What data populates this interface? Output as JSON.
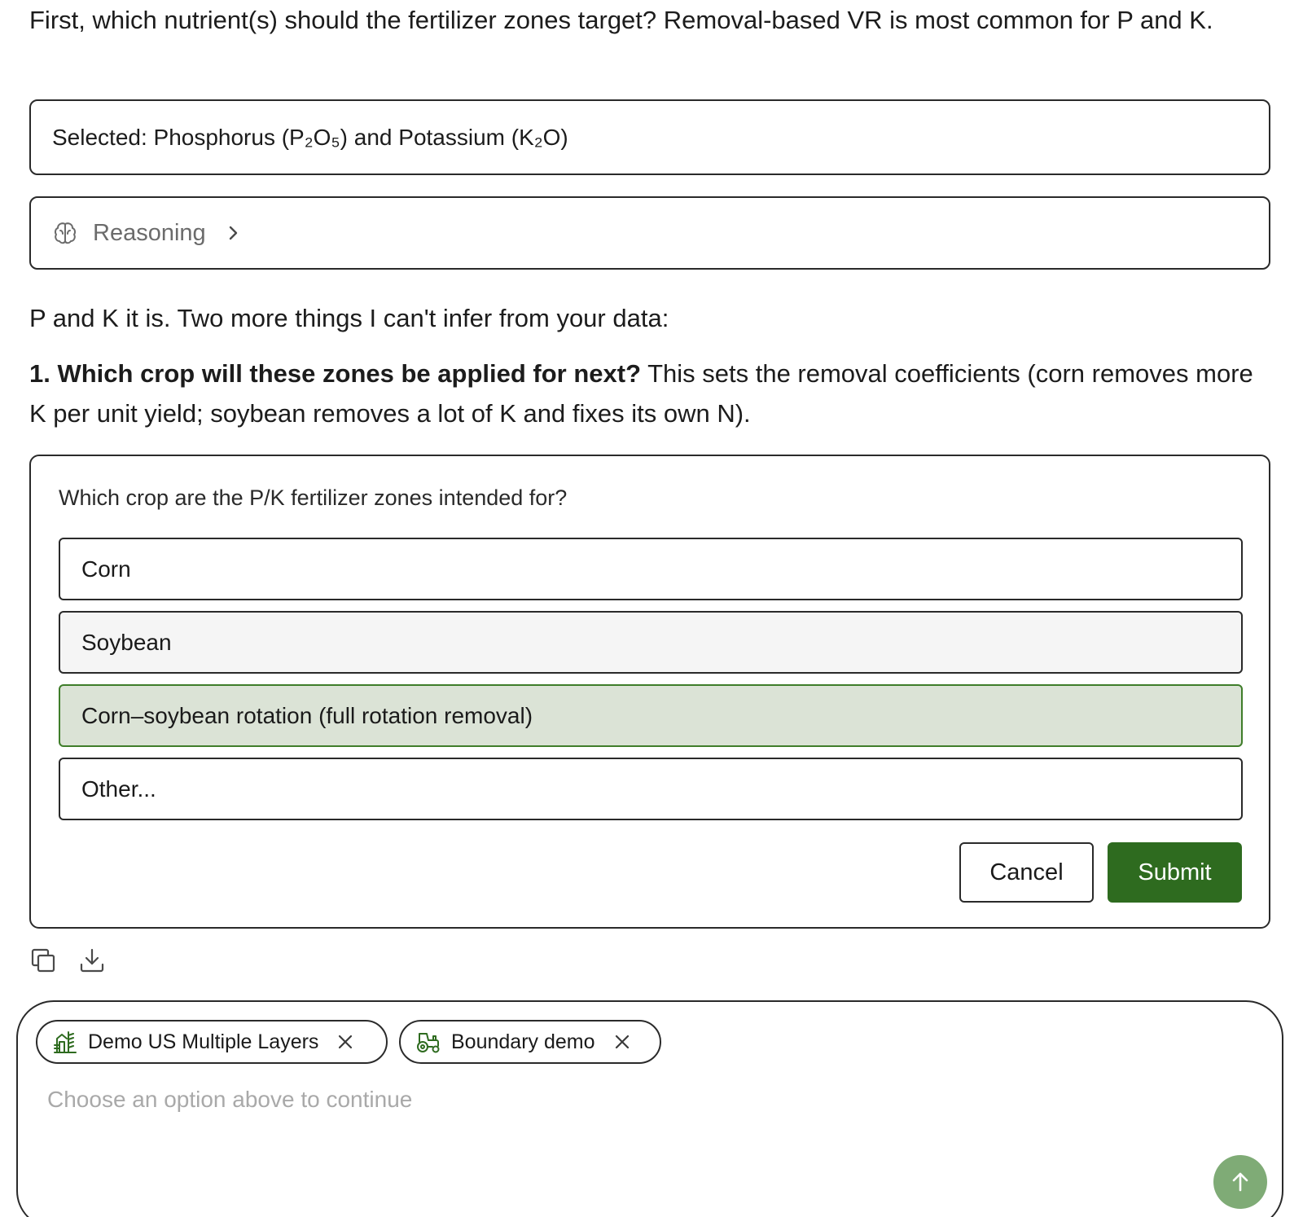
{
  "messages": {
    "intro": "First, which nutrient(s) should the fertilizer zones target? Removal-based VR is most common for P and K.",
    "selected_answer": "Selected: Phosphorus (P₂O₅) and Potassium (K₂O)",
    "reasoning_label": "Reasoning",
    "followup": "P and K it is. Two more things I can't infer from your data:",
    "question_bold": "1. Which crop will these zones be applied for next?",
    "question_rest": " This sets the removal coefficients (corn removes more K per unit yield; soybean removes a lot of K and fixes its own N)."
  },
  "question_card": {
    "prompt": "Which crop are the P/K fertilizer zones intended for?",
    "options": [
      {
        "label": "Corn",
        "state": "default"
      },
      {
        "label": "Soybean",
        "state": "hover"
      },
      {
        "label": "Corn–soybean rotation (full rotation removal)",
        "state": "selected"
      },
      {
        "label": "Other...",
        "state": "default"
      }
    ],
    "cancel_label": "Cancel",
    "submit_label": "Submit"
  },
  "message_actions": {
    "icons": [
      "copy-icon",
      "download-icon"
    ]
  },
  "composer": {
    "chips": [
      {
        "label": "Demo US Multiple Layers",
        "icon": "field-layers-icon"
      },
      {
        "label": "Boundary demo",
        "icon": "tractor-icon"
      }
    ],
    "placeholder": "Choose an option above to continue",
    "send_icon": "arrow-up-icon"
  },
  "colors": {
    "accent_green": "#2e6b1f",
    "selected_option_bg": "#dbe3d6",
    "send_button_bg": "#7fab76",
    "border": "#2a2a2a"
  }
}
